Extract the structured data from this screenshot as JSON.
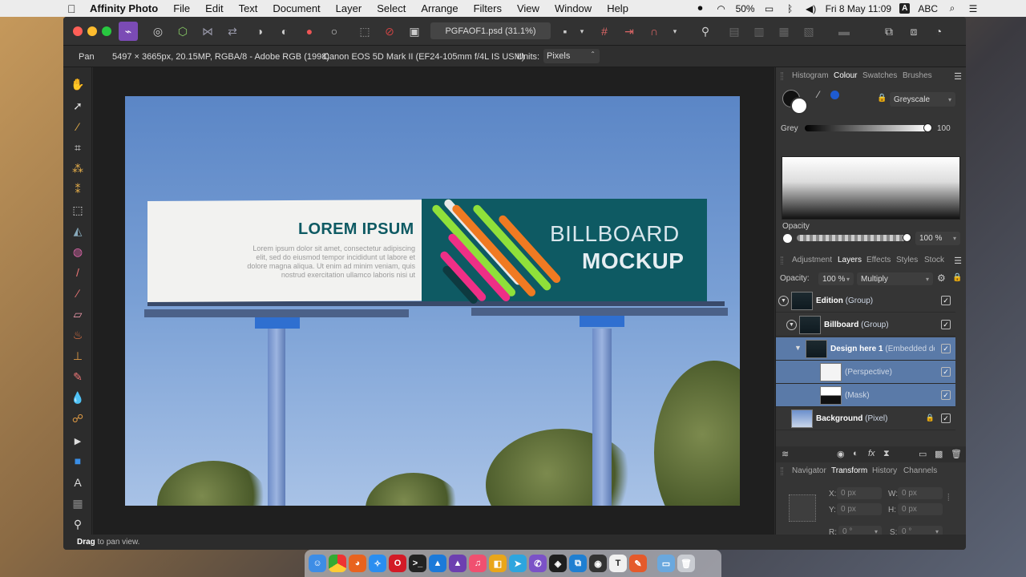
{
  "menubar": {
    "app_name": "Affinity Photo",
    "items": [
      "File",
      "Edit",
      "Text",
      "Document",
      "Layer",
      "Select",
      "Arrange",
      "Filters",
      "View",
      "Window",
      "Help"
    ],
    "battery": "50%",
    "date_time": "Fri 8 May  11:09",
    "input_source": "ABC",
    "input_badge": "A"
  },
  "toolbar": {
    "document_tab": "PGFAOF1.psd (31.1%)"
  },
  "context_bar": {
    "tool": "Pan",
    "image_info": "5497 × 3665px, 20.15MP, RGBA/8 - Adobe RGB (1998)",
    "camera": "Canon EOS 5D Mark II (EF24-105mm f/4L IS USM)",
    "units_label": "Units:",
    "units_value": "Pixels"
  },
  "billboard": {
    "headline_a": "LOREM ",
    "headline_b": "IPSUM",
    "body": "Lorem ipsum dolor sit amet, consectetur adipiscing elit, sed do eiusmod tempor incididunt ut labore et dolore magna aliqua. Ut enim ad minim veniam, quis nostrud exercitation ullamco laboris nisi ut",
    "title_1": "BILLBOARD",
    "title_2": "MOCKUP"
  },
  "colour_panel": {
    "tabs": [
      "Histogram",
      "Colour",
      "Swatches",
      "Brushes"
    ],
    "active_tab": "Colour",
    "mode": "Greyscale",
    "grey_label": "Grey",
    "grey_value": "100",
    "opacity_label": "Opacity",
    "opacity_value": "100 %"
  },
  "layers_panel": {
    "tabs": [
      "Adjustment",
      "Layers",
      "Effects",
      "Styles",
      "Stock"
    ],
    "active_tab": "Layers",
    "opacity_label": "Opacity:",
    "opacity_value": "100 %",
    "blend_mode": "Multiply",
    "layers": [
      {
        "name": "Edition",
        "kind": "(Group)",
        "selected": false
      },
      {
        "name": "Billboard",
        "kind": "(Group)",
        "selected": false
      },
      {
        "name": "Design here 1",
        "kind": "(Embedded doc",
        "selected": true
      },
      {
        "name": "",
        "kind": "(Perspective)",
        "selected": true
      },
      {
        "name": "",
        "kind": "(Mask)",
        "selected": true
      },
      {
        "name": "Background",
        "kind": "(Pixel)",
        "selected": false
      }
    ]
  },
  "transform_panel": {
    "tabs": [
      "Navigator",
      "Transform",
      "History",
      "Channels"
    ],
    "active_tab": "Transform",
    "x_label": "X:",
    "x_value": "0 px",
    "y_label": "Y:",
    "y_value": "0 px",
    "w_label": "W:",
    "w_value": "0 px",
    "h_label": "H:",
    "h_value": "0 px",
    "r_label": "R:",
    "r_value": "0 °",
    "s_label": "S:",
    "s_value": "0 °"
  },
  "status": {
    "bold": "Drag",
    "rest": " to pan view."
  },
  "dock_icons": [
    "finder",
    "chrome",
    "firefox",
    "safari",
    "opera",
    "terminal",
    "affinity-designer",
    "affinity-photo",
    "itunes",
    "keynote",
    "telegram",
    "viber",
    "figma",
    "vscode",
    "github",
    "typora",
    "flare",
    "folder",
    "trash"
  ]
}
